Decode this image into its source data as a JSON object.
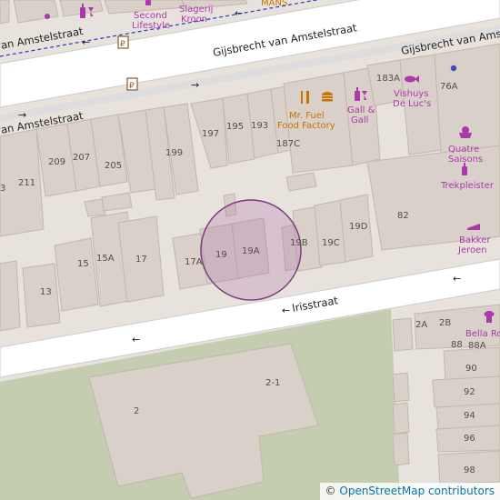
{
  "map": {
    "streets": {
      "gijsbrecht_left": "van Amstelstraat",
      "gijsbrecht_main": "Gijsbrecht van Amstelstraat",
      "gijsbrecht_right": "Gijsbrecht van Amste",
      "gijsbrecht_lower": "van Amstelstraat",
      "irisstraat": "Irisstraat"
    },
    "pois": {
      "second_lifestyle": "Second Lifestyle",
      "slagerij_kroon": "Slagerij Kroon",
      "mans": "MANS",
      "mr_fuel": "Mr. Fuel Food Factory",
      "gall": "Gall & Gall",
      "vishuys": "Vishuys De Luc's",
      "quatre": "Quatre Saisons",
      "trekpleister": "Trekpleister",
      "bakker": "Bakker Jeroen",
      "bella": "Bella Ro"
    },
    "house_numbers": [
      "3",
      "211",
      "209",
      "207",
      "205",
      "199",
      "197",
      "195",
      "193",
      "187C",
      "183A",
      "76A",
      "82",
      "19D",
      "19C",
      "19B",
      "19A",
      "19",
      "17A",
      "17",
      "15A",
      "15",
      "13",
      "2A",
      "2B",
      "88",
      "88A",
      "90",
      "92",
      "94",
      "96",
      "98",
      "2-1",
      "2"
    ],
    "colors": {
      "background": "#f2efe9",
      "building": "#d9d0c9",
      "road": "#ffffff",
      "footway": "#dddddd",
      "cycleway": "#2b35c9",
      "green": "#c5cdb1",
      "poi_shop": "#ac39ac",
      "poi_food": "#c77400",
      "marker": "#a765a9"
    },
    "icons": [
      "wine-bottle-icon",
      "dot-icon",
      "bus-ticket-icon",
      "restaurant-icon",
      "burger-icon",
      "fish-icon",
      "dessert-icon",
      "bakery-icon",
      "clothes-icon",
      "arrow-icon"
    ]
  },
  "attribution": {
    "symbol": "©",
    "text": "OpenStreetMap contributors"
  }
}
